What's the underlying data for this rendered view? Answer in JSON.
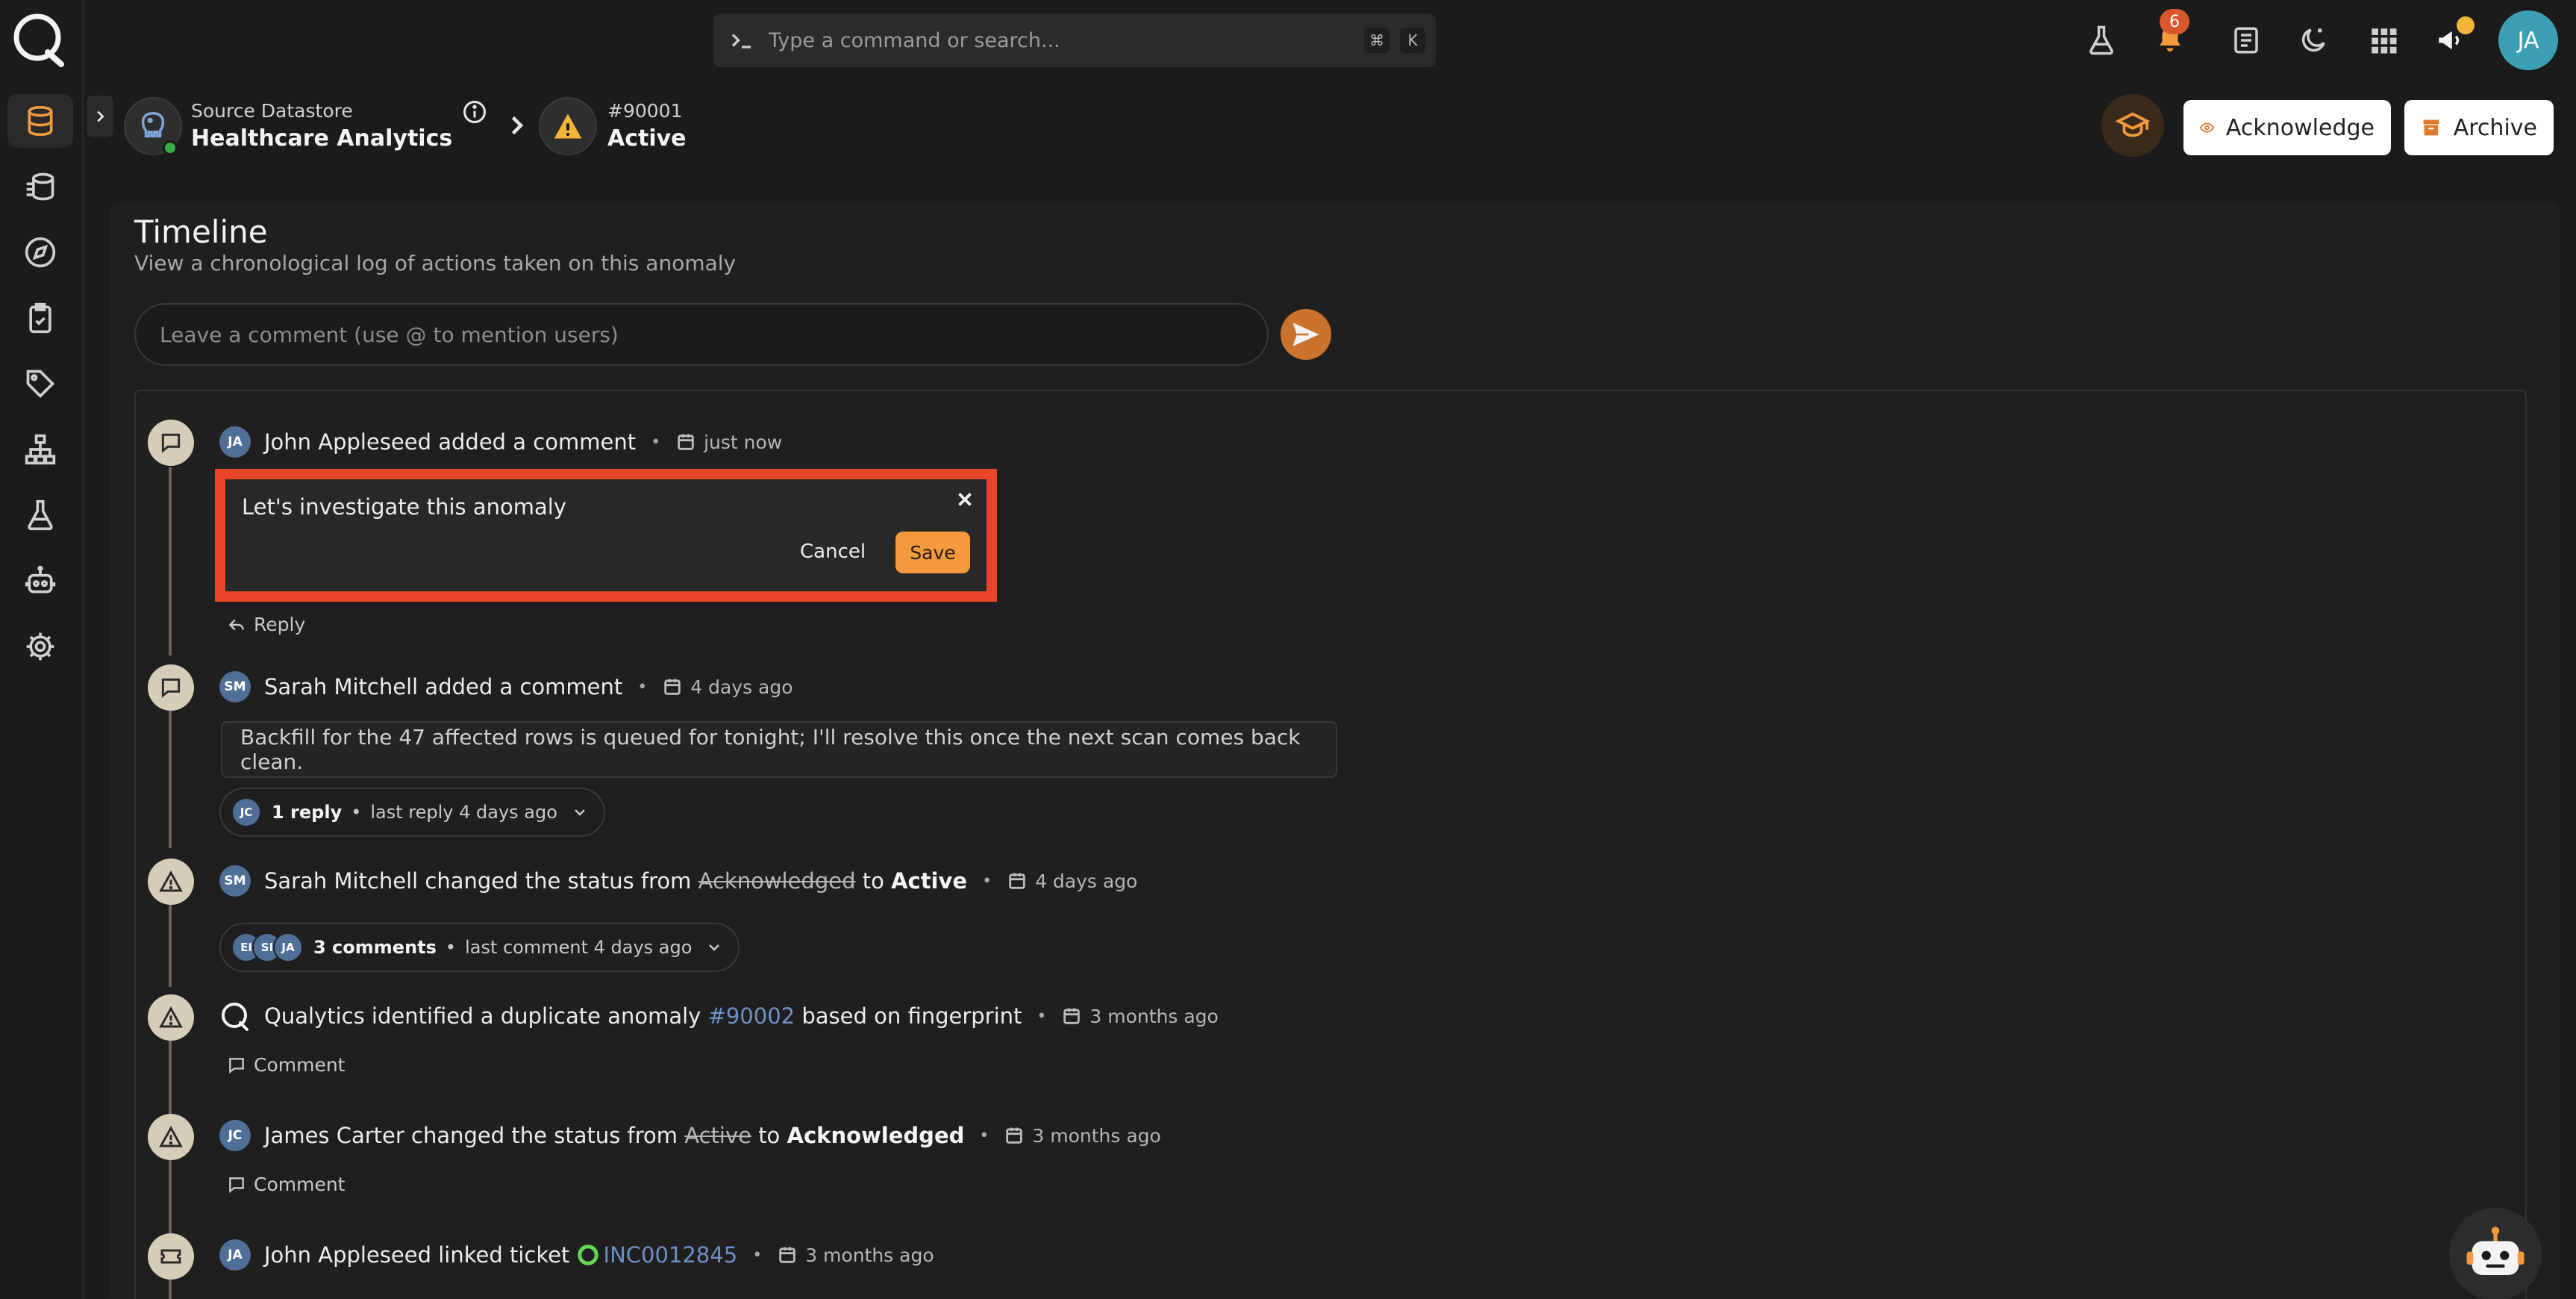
{
  "colors": {
    "accent": "#f29a3d",
    "danger_outline": "#e8452a",
    "avatar": "#4f6f98",
    "user_avatar": "#3c9fb5",
    "status_online": "#35b048"
  },
  "topbar": {
    "command_placeholder": "Type a command or search...",
    "shortcut_keys": [
      "⌘",
      "K"
    ],
    "notification_count": "6",
    "user_initials": "JA"
  },
  "breadcrumb": {
    "datastore_label": "Source Datastore",
    "datastore_name": "Healthcare Analytics",
    "anomaly_id": "#90001",
    "anomaly_status": "Active"
  },
  "actions": {
    "acknowledge_label": "Acknowledge",
    "archive_label": "Archive"
  },
  "timeline": {
    "title": "Timeline",
    "subtitle": "View a chronological log of actions taken on this anomaly",
    "comment_placeholder": "Leave a comment (use @ to mention users)",
    "events": [
      {
        "initials": "JA",
        "actor": "John Appleseed",
        "action": "added a comment",
        "time": "just now",
        "edit": {
          "text": "Let's investigate this anomaly",
          "cancel": "Cancel",
          "save": "Save"
        },
        "reply_label": "Reply"
      },
      {
        "initials": "SM",
        "actor": "Sarah Mitchell",
        "action": "added a comment",
        "time": "4 days ago",
        "body": "Backfill for the 47 affected rows is queued for tonight; I'll resolve this once the next scan comes back clean.",
        "thread": {
          "avatars": [
            "JC"
          ],
          "count": "1 reply",
          "last": "last reply 4 days ago"
        }
      },
      {
        "initials": "SM",
        "actor": "Sarah Mitchell",
        "action": "changed the status from",
        "from": "Acknowledged",
        "to_word": "to",
        "to": "Active",
        "time": "4 days ago",
        "thread": {
          "avatars": [
            "EI",
            "SI",
            "JA"
          ],
          "count": "3 comments",
          "last": "last comment 4 days ago"
        }
      },
      {
        "actor": "Qualytics",
        "action": "identified a duplicate anomaly",
        "link": "#90002",
        "tail": "based on fingerprint",
        "time": "3 months ago",
        "comment_label": "Comment"
      },
      {
        "initials": "JC",
        "actor": "James Carter",
        "action": "changed the status from",
        "from": "Active",
        "to_word": "to",
        "to": "Acknowledged",
        "time": "3 months ago",
        "comment_label": "Comment"
      },
      {
        "initials": "JA",
        "actor": "John Appleseed",
        "action": "linked ticket",
        "ticket": "INC0012845",
        "time": "3 months ago"
      }
    ]
  }
}
